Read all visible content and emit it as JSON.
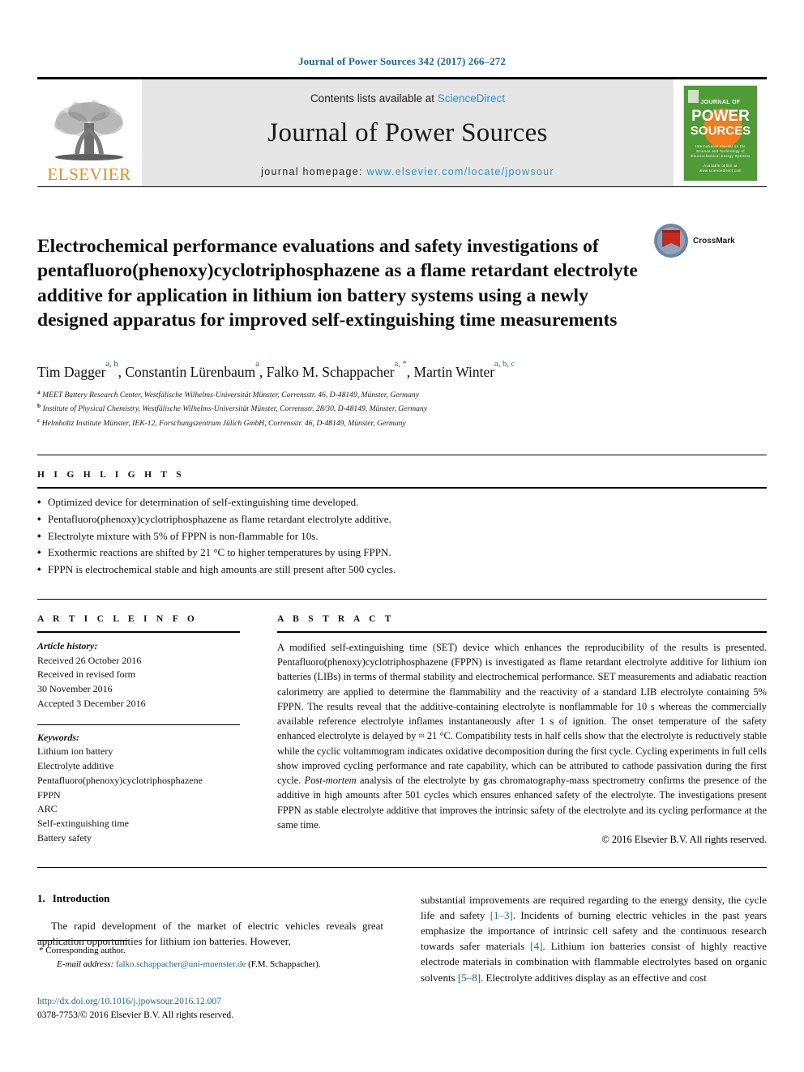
{
  "running_head": "Journal of Power Sources 342 (2017) 266–272",
  "masthead": {
    "contents_prefix": "Contents lists available at ",
    "sciencedirect": "ScienceDirect",
    "journal_name": "Journal of Power Sources",
    "homepage_prefix": "journal homepage: ",
    "homepage_url": "www.elsevier.com/locate/jpowsour",
    "publisher_logo_text": "ELSEVIER",
    "cover": {
      "line1": "JOURNAL OF",
      "line2": "POWER",
      "line3": "SOURCES",
      "subtitle": "International Journal on the Science and Technology of Electrochemical Energy Systems",
      "footer": "Available online at www.sciencedirect.com"
    },
    "accent_blue": "#2a93d5",
    "elsevier_orange": "#ec8b22",
    "cover_green": "#4f9b36"
  },
  "article": {
    "title": "Electrochemical performance evaluations and safety investigations of pentafluoro(phenoxy)cyclotriphosphazene as a flame retardant electrolyte additive for application in lithium ion battery systems using a newly designed apparatus for improved self-extinguishing time measurements",
    "crossmark_label": "CrossMark",
    "authors": [
      {
        "name": "Tim Dagger",
        "sup": "a, b",
        "sep": ", "
      },
      {
        "name": "Constantin Lürenbaum",
        "sup": "a",
        "sep": ", "
      },
      {
        "name": "Falko M. Schappacher",
        "sup": "a, *",
        "sep": ", "
      },
      {
        "name": "Martin Winter",
        "sup": "a, b, c",
        "sep": ""
      }
    ],
    "affiliations": [
      {
        "marker": "a",
        "text": "MEET Battery Research Center, Westfälische Wilhelms-Universität Münster, Corrensstr. 46, D-48149, Münster, Germany"
      },
      {
        "marker": "b",
        "text": "Institute of Physical Chemistry, Westfälische Wilhelms-Universität Münster, Corrensstr. 28/30, D-48149, Münster, Germany"
      },
      {
        "marker": "c",
        "text": "Helmholtz Institute Münster, IEK-12, Forschungszentrum Jülich GmbH, Corrensstr. 46, D-48149, Münster, Germany"
      }
    ]
  },
  "highlights": {
    "heading": "H I G H L I G H T S",
    "items": [
      "Optimized device for determination of self-extinguishing time developed.",
      "Pentafluoro(phenoxy)cyclotriphosphazene as flame retardant electrolyte additive.",
      "Electrolyte mixture with 5% of FPPN is non-flammable for 10s.",
      "Exothermic reactions are shifted by 21 °C to higher temperatures by using FPPN.",
      "FPPN is electrochemical stable and high amounts are still present after 500 cycles."
    ]
  },
  "article_info": {
    "heading": "A R T I C L E  I N F O",
    "history_label": "Article history:",
    "history_lines": [
      "Received 26 October 2016",
      "Received in revised form",
      "30 November 2016",
      "Accepted 3 December 2016"
    ],
    "keywords_label": "Keywords:",
    "keywords": [
      "Lithium ion battery",
      "Electrolyte additive",
      "Pentafluoro(phenoxy)cyclotriphosphazene",
      "FPPN",
      "ARC",
      "Self-extinguishing time",
      "Battery safety"
    ]
  },
  "abstract": {
    "heading": "A B S T R A C T",
    "paragraph_1": "A modified self-extinguishing time (SET) device which enhances the reproducibility of the results is presented. Pentafluoro(phenoxy)cyclotriphosphazene (FPPN) is investigated as flame retardant electrolyte additive for lithium ion batteries (LIBs) in terms of thermal stability and electrochemical performance. SET measurements and adiabatic reaction calorimetry are applied to determine the flammability and the reactivity of a standard LIB electrolyte containing 5% FPPN. The results reveal that the additive-containing electrolyte is nonflammable for 10 s whereas the commercially available reference electrolyte inflames instantaneously after 1 s of ignition. The onset temperature of the safety enhanced electrolyte is delayed by ≈ 21 °C. Compatibility tests in half cells show that the electrolyte is reductively stable while the cyclic voltammogram indicates oxidative decomposition during the first cycle. Cycling experiments in full cells show improved cycling performance and rate capability, which can be attributed to cathode passivation during the first cycle. ",
    "italic_phrase": "Post-mortem",
    "paragraph_2": " analysis of the electrolyte by gas chromatography-mass spectrometry confirms the presence of the additive in high amounts after 501 cycles which ensures enhanced safety of the electrolyte. The investigations present FPPN as stable electrolyte additive that improves the intrinsic safety of the electrolyte and its cycling performance at the same time.",
    "copyright": "© 2016 Elsevier B.V. All rights reserved."
  },
  "body": {
    "section_number": "1.",
    "section_title": "Introduction",
    "left_paragraph": "The rapid development of the market of electric vehicles reveals great application opportunities for lithium ion batteries. However,",
    "right_paragraph_parts": [
      {
        "type": "text",
        "value": "substantial improvements are required regarding to the energy density, the cycle life and safety "
      },
      {
        "type": "ref",
        "value": "[1–3]"
      },
      {
        "type": "text",
        "value": ". Incidents of burning electric vehicles in the past years emphasize the importance of intrinsic cell safety and the continuous research towards safer materials "
      },
      {
        "type": "ref",
        "value": "[4]"
      },
      {
        "type": "text",
        "value": ". Lithium ion batteries consist of highly reactive electrode materials in combination with flammable electrolytes based on organic solvents "
      },
      {
        "type": "ref",
        "value": "[5–8]"
      },
      {
        "type": "text",
        "value": ". Electrolyte additives display as an effective and cost"
      }
    ]
  },
  "footnote": {
    "corresponding_star": "*",
    "corresponding_text": "Corresponding author.",
    "email_label": "E-mail address:",
    "email": "falko.schappacher@uni-muenster.de",
    "email_owner": "(F.M. Schappacher)."
  },
  "bottom": {
    "doi": "http://dx.doi.org/10.1016/j.jpowsour.2016.12.007",
    "issn_line": "0378-7753/© 2016 Elsevier B.V. All rights reserved."
  }
}
